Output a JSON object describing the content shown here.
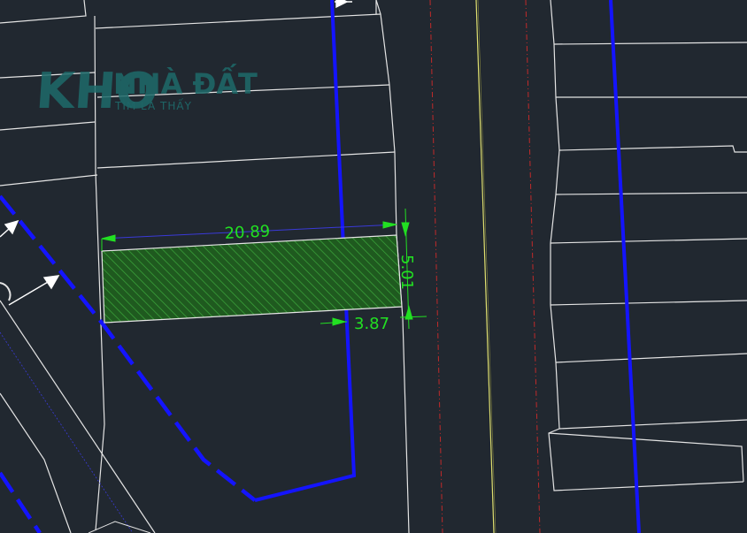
{
  "watermark": {
    "logo_text": "KHO",
    "brand_text": "NHÀ ĐẤT",
    "tagline": "TÌM LÀ THẤY"
  },
  "drawing": {
    "colors": {
      "background": "#212830",
      "lot_lines": "#e4e4e4",
      "boundary": "#1414ff",
      "highlight_fill": "#1f5a1f",
      "hatch": "#3ca83c",
      "dimension": "#22e022",
      "center_line": "#c02a2a",
      "road_edge": "#e0e070"
    },
    "dimensions": {
      "width": "20.89",
      "depth": "5.01",
      "offset": "3.87"
    }
  }
}
